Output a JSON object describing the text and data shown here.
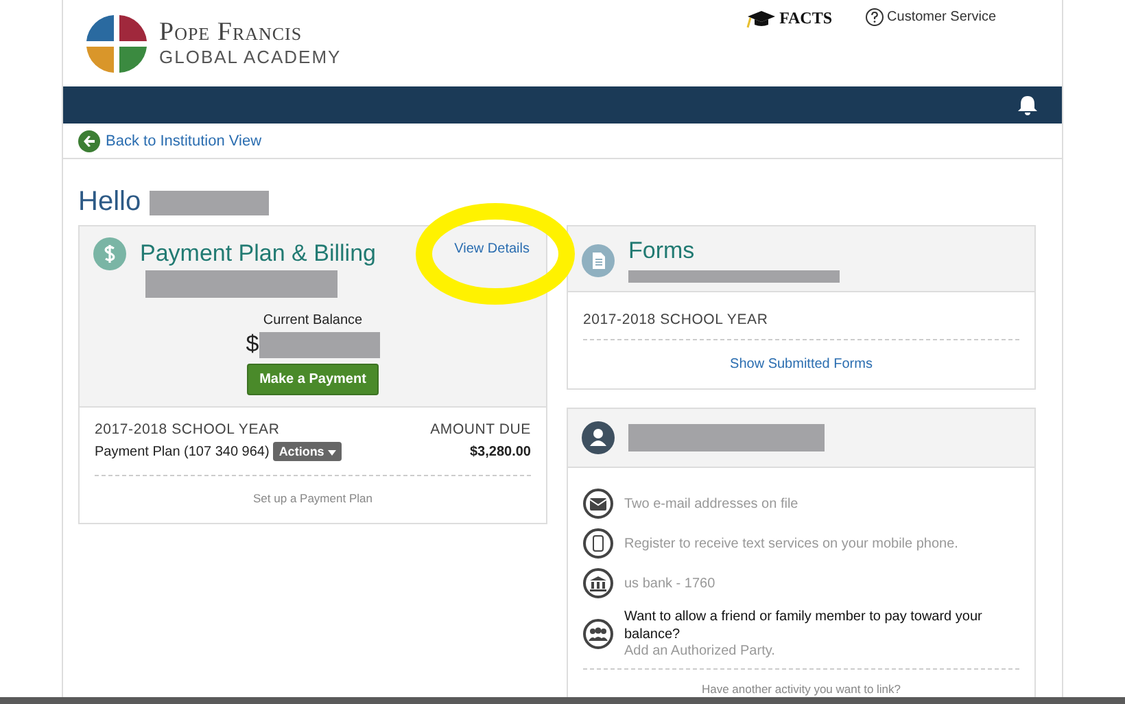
{
  "header": {
    "logo_line1": "Pope Francis",
    "logo_line2": "GLOBAL ACADEMY",
    "facts": "FACTS",
    "customer_service": "Customer Service"
  },
  "back_link": "Back to Institution View",
  "greeting": "Hello",
  "billing": {
    "title": "Payment Plan & Billing",
    "view_details": "View Details",
    "balance_label": "Current Balance",
    "balance_prefix": "$",
    "pay_button": "Make a Payment",
    "year": "2017-2018 SCHOOL YEAR",
    "amount_due_label": "AMOUNT DUE",
    "plan": "Payment Plan (107 340 964)",
    "actions": "Actions",
    "amount": "$3,280.00",
    "setup_link": "Set up a Payment Plan"
  },
  "forms": {
    "title": "Forms",
    "year": "2017-2018 SCHOOL YEAR",
    "link": "Show Submitted Forms"
  },
  "account": {
    "items": [
      {
        "kind": "email",
        "text": "Two e-mail addresses on file"
      },
      {
        "kind": "phone",
        "text": "Register to receive text services on your mobile phone."
      },
      {
        "kind": "bank",
        "text": "us bank - 1760"
      },
      {
        "kind": "party",
        "text": "Want to allow a friend or family member to pay toward your balance?",
        "link": "Add an Authorized Party."
      }
    ],
    "footer": "Have another activity you want to link?"
  }
}
